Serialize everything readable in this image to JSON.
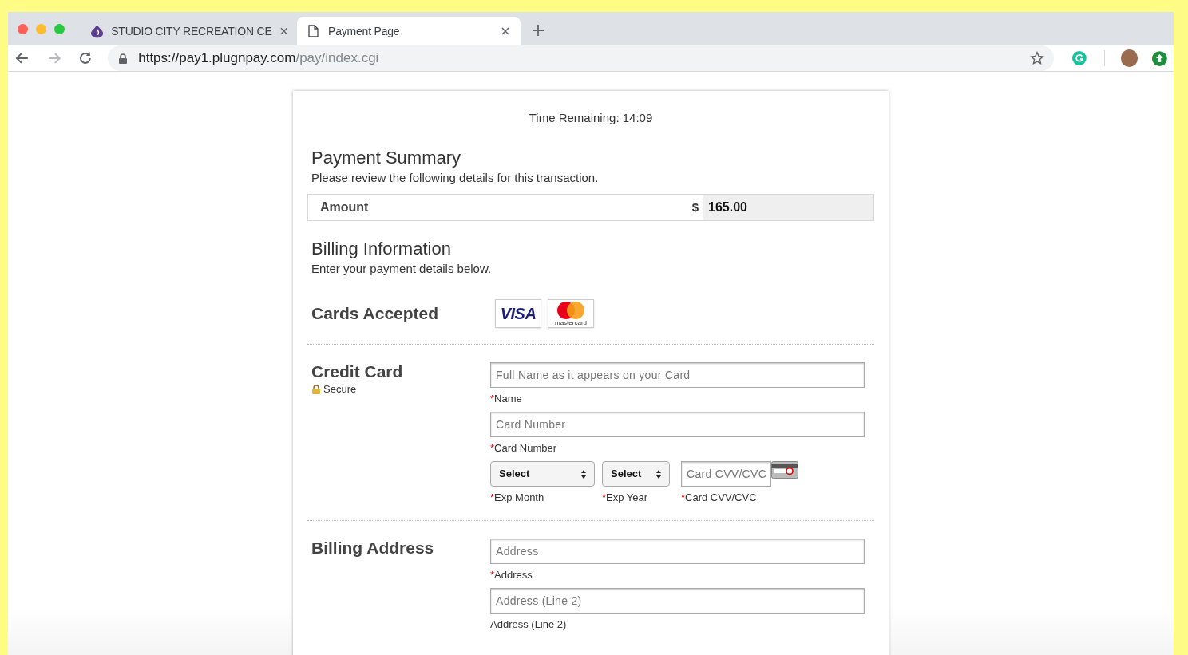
{
  "browser": {
    "tabs": [
      {
        "kind": "site",
        "title": "STUDIO CITY RECREATION CE",
        "selected": false
      },
      {
        "kind": "page",
        "title": "Payment Page",
        "selected": true
      }
    ],
    "url": {
      "host": "https://pay1.plugnpay.com",
      "path": "/pay/index.cgi"
    }
  },
  "timer": "Time Remaining: 14:09",
  "summary": {
    "title": "Payment Summary",
    "subtitle": "Please review the following details for this transaction.",
    "amount_label": "Amount",
    "currency": "$",
    "amount": "165.00"
  },
  "billing": {
    "title": "Billing Information",
    "subtitle": "Enter your payment details below."
  },
  "cards_accepted": {
    "title": "Cards Accepted",
    "cards": [
      {
        "kind": "visa",
        "label": "VISA"
      },
      {
        "kind": "mastercard",
        "label": "mastercard"
      }
    ]
  },
  "credit_card": {
    "title": "Credit Card",
    "secure": "Secure",
    "fields": [
      {
        "kind": "text",
        "placeholder": "Full Name as it appears on your Card",
        "mark": "*",
        "label": "Name"
      },
      {
        "kind": "text",
        "placeholder": "Card Number",
        "mark": "*",
        "label": "Card Number"
      }
    ],
    "row": [
      {
        "kind": "select",
        "value": "Select",
        "mark": "*",
        "label": "Exp Month"
      },
      {
        "kind": "select",
        "value": "Select",
        "mark": "*",
        "label": "Exp Year"
      },
      {
        "kind": "text",
        "placeholder": "Card CVV/CVC",
        "mark": "*",
        "label": "Card CVV/CVC"
      }
    ]
  },
  "billing_address": {
    "title": "Billing Address",
    "fields": [
      {
        "kind": "text",
        "placeholder": "Address",
        "mark": "*",
        "label": "Address"
      },
      {
        "kind": "text",
        "placeholder": "Address (Line 2)",
        "label": "Address (Line 2)"
      }
    ]
  }
}
